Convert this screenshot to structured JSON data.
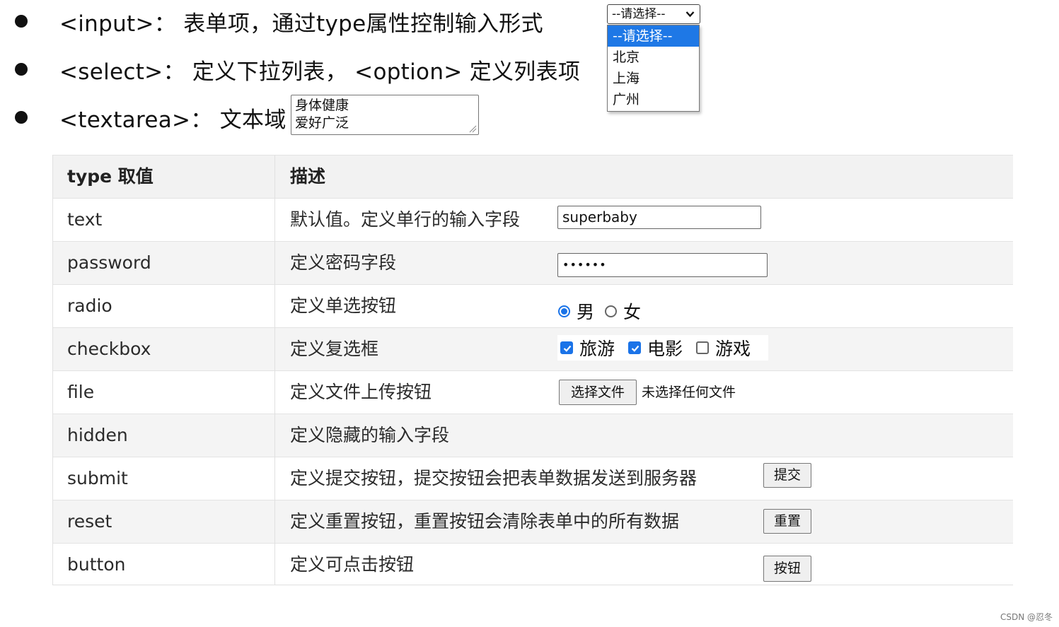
{
  "bullets": [
    {
      "text": "<input>：  表单项，通过type属性控制输入形式"
    },
    {
      "text": "<select>：  定义下拉列表，  <option>  定义列表项"
    },
    {
      "text": "<textarea>：  文本域"
    }
  ],
  "textarea_demo": {
    "lines": [
      "身体健康",
      "爱好广泛"
    ]
  },
  "select_demo": {
    "value": "--请选择--",
    "options": [
      "--请选择--",
      "北京",
      "上海",
      "广州"
    ],
    "selected_index": 0
  },
  "table": {
    "headers": [
      "type 取值",
      "描述"
    ],
    "rows": [
      {
        "type": "text",
        "desc": "默认值。定义单行的输入字段"
      },
      {
        "type": "password",
        "desc": "定义密码字段"
      },
      {
        "type": "radio",
        "desc": "定义单选按钮"
      },
      {
        "type": "checkbox",
        "desc": "定义复选框"
      },
      {
        "type": "file",
        "desc": "定义文件上传按钮"
      },
      {
        "type": "hidden",
        "desc": "定义隐藏的输入字段"
      },
      {
        "type": "submit",
        "desc": "定义提交按钮，提交按钮会把表单数据发送到服务器"
      },
      {
        "type": "reset",
        "desc": "定义重置按钮，重置按钮会清除表单中的所有数据"
      },
      {
        "type": "button",
        "desc": "定义可点击按钮"
      }
    ]
  },
  "controls": {
    "text_value": "superbaby",
    "password_mask": "••••••",
    "radio": [
      {
        "label": "男",
        "checked": true
      },
      {
        "label": "女",
        "checked": false
      }
    ],
    "checkbox": [
      {
        "label": "旅游",
        "checked": true
      },
      {
        "label": "电影",
        "checked": true
      },
      {
        "label": "游戏",
        "checked": false
      }
    ],
    "file_button": "选择文件",
    "file_status": "未选择任何文件",
    "submit_label": "提交",
    "reset_label": "重置",
    "button_label": "按钮"
  },
  "watermark": "CSDN @忍冬",
  "colors": {
    "accent": "#1a73e8",
    "select_highlight": "#1e78e6"
  }
}
